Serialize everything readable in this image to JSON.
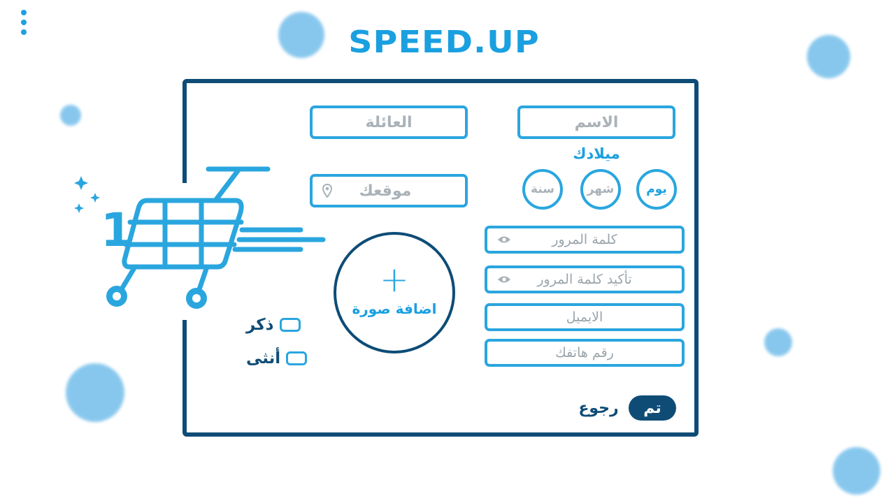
{
  "app": {
    "logo_text": "SPEED.UP"
  },
  "colors": {
    "primary": "#1aa0e0",
    "field_border": "#2aa6df",
    "dark": "#0e4c76",
    "placeholder": "#a9b2b8",
    "blob": "#7cc2ec"
  },
  "icons": {
    "menu": "kebab-menu-icon",
    "location": "location-pin-icon",
    "eye": "eye-icon",
    "plus": "plus-icon",
    "cart": "shopping-cart-icon"
  },
  "form": {
    "first_name": {
      "placeholder": "الاسم"
    },
    "family_name": {
      "placeholder": "العائلة"
    },
    "birthday": {
      "label": "ميلادك",
      "day": "يوم",
      "month": "شهر",
      "year": "سنة"
    },
    "location": {
      "placeholder": "موقعك"
    },
    "password": {
      "placeholder": "كلمة المرور"
    },
    "confirm_password": {
      "placeholder": "تأكيد كلمة المرور"
    },
    "email": {
      "placeholder": "الايميل"
    },
    "phone": {
      "placeholder": "رقم هاتفك"
    },
    "photo": {
      "plus": "+",
      "label": "اضافة صورة"
    },
    "gender": {
      "male": "ذكر",
      "female": "أنثى"
    },
    "actions": {
      "done": "تم",
      "back": "رجوع"
    }
  },
  "cart": {
    "count": "1"
  }
}
